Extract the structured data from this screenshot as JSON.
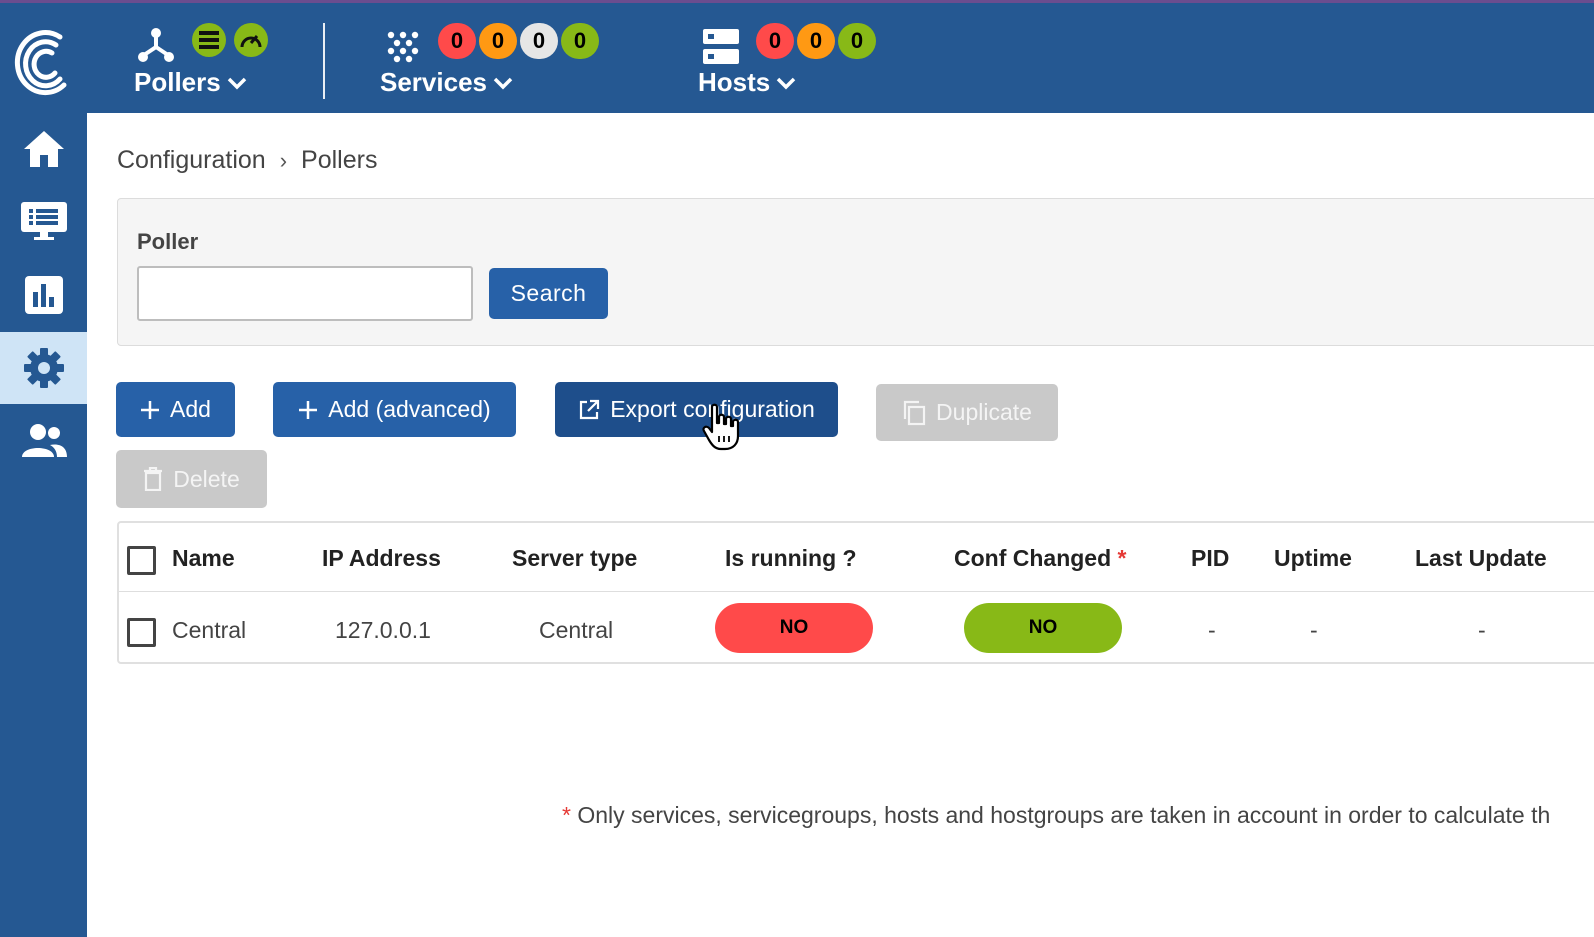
{
  "topbar": {
    "pollers": {
      "label": "Pollers",
      "database_icon": "database-icon",
      "gauge_icon": "gauge-icon"
    },
    "services": {
      "label": "Services",
      "badges": [
        "0",
        "0",
        "0",
        "0"
      ]
    },
    "hosts": {
      "label": "Hosts",
      "badges": [
        "0",
        "0",
        "0"
      ]
    }
  },
  "sidebar": {
    "items": [
      {
        "name": "home",
        "icon": "home-icon"
      },
      {
        "name": "monitoring",
        "icon": "monitor-icon"
      },
      {
        "name": "reporting",
        "icon": "chart-icon"
      },
      {
        "name": "configuration",
        "icon": "gear-icon",
        "active": true
      },
      {
        "name": "administration",
        "icon": "users-icon"
      }
    ]
  },
  "breadcrumb": {
    "items": [
      "Configuration",
      "Pollers"
    ],
    "separator": "›"
  },
  "filter": {
    "label": "Poller",
    "value": "",
    "search_label": "Search"
  },
  "actions": {
    "add": "Add",
    "add_advanced": "Add (advanced)",
    "export": "Export configuration",
    "duplicate": "Duplicate",
    "delete": "Delete"
  },
  "table": {
    "headers": {
      "name": "Name",
      "ip": "IP Address",
      "server_type": "Server type",
      "is_running": "Is running ?",
      "conf_changed": "Conf Changed",
      "conf_changed_mark": "*",
      "pid": "PID",
      "uptime": "Uptime",
      "last_update": "Last Update"
    },
    "rows": [
      {
        "name": "Central",
        "ip": "127.0.0.1",
        "server_type": "Central",
        "is_running": "NO",
        "conf_changed": "NO",
        "pid": "-",
        "uptime": "-",
        "last_update": "-"
      }
    ]
  },
  "footnote": {
    "mark": "*",
    "text": "Only services, servicegroups, hosts and hostgroups are taken in account in order to calculate th"
  },
  "colors": {
    "brand": "#255892",
    "primary_button": "#2761a8",
    "critical": "#ff4a4a",
    "warning": "#ff9913",
    "unknown": "#e6e6e6",
    "ok": "#88b917"
  }
}
